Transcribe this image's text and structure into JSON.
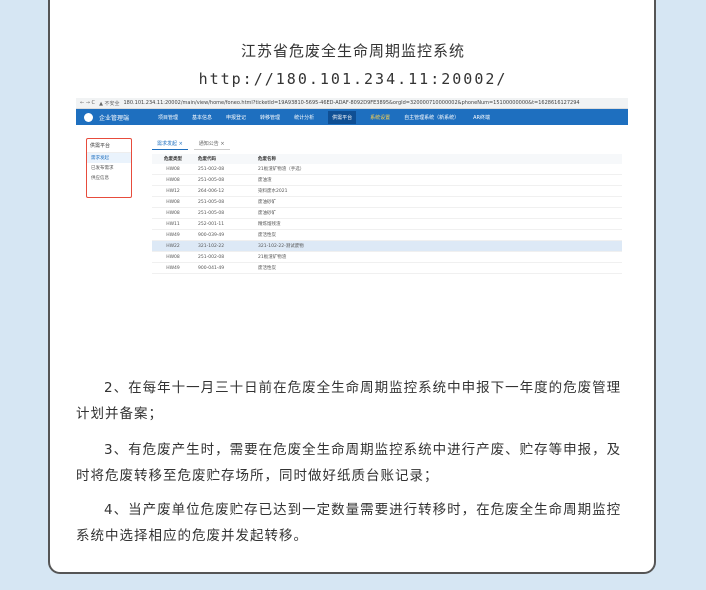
{
  "header": {
    "title": "江苏省危废全生命周期监控系统",
    "url": "http://180.101.234.11:20002/"
  },
  "browser": {
    "nav": "← → C",
    "security": "▲ 不安全",
    "url": "180.101.234.11:20002/main/view/home/foneo.html?ticketId=19A93810-5695-46ED-ADAF-8092D9FE3895&orgId=320000710000002&phoneNum=15100000000&t=1628616127294",
    "logo": "企业管理端",
    "menu": [
      "项目管理",
      "基本信息",
      "申报登记",
      "转移管理",
      "统计分析",
      "供需平台",
      "系统设置",
      "自主管理系统（新系统）",
      "AR终端"
    ],
    "left_title": "供需平台",
    "left_items": [
      "需求发起",
      "已发布需求",
      "供应信息"
    ],
    "tabs": [
      "需求发起 ×",
      "通知公告 ×"
    ],
    "columns": [
      "危废类型",
      "危废代码",
      "危废名称"
    ],
    "rows": [
      [
        "HW08",
        "251-002-08",
        "21板渣矿物渣（手选）"
      ],
      [
        "HW08",
        "251-005-08",
        "废油渣"
      ],
      [
        "HW12",
        "264-006-12",
        "染料废水2021"
      ],
      [
        "HW08",
        "251-005-08",
        "废油砂矿"
      ],
      [
        "HW08",
        "251-005-08",
        "废油砂矿"
      ],
      [
        "HW11",
        "252-001-11",
        "精炼馏残渣"
      ],
      [
        "HW49",
        "900-039-49",
        "废活性炭"
      ],
      [
        "HW22",
        "321-102-22",
        "321-102-22-测试废物"
      ],
      [
        "HW08",
        "251-002-08",
        "21板渣矿物渣"
      ],
      [
        "HW49",
        "900-041-49",
        "废活性炭"
      ]
    ]
  },
  "paragraphs": [
    "2、在每年十一月三十日前在危废全生命周期监控系统中申报下一年度的危废管理计划并备案；",
    "3、有危废产生时，需要在危废全生命周期监控系统中进行产废、贮存等申报，及时将危废转移至危废贮存场所，同时做好纸质台账记录；",
    "4、当产废单位危废贮存已达到一定数量需要进行转移时，在危废全生命周期监控系统中选择相应的危废并发起转移。"
  ]
}
